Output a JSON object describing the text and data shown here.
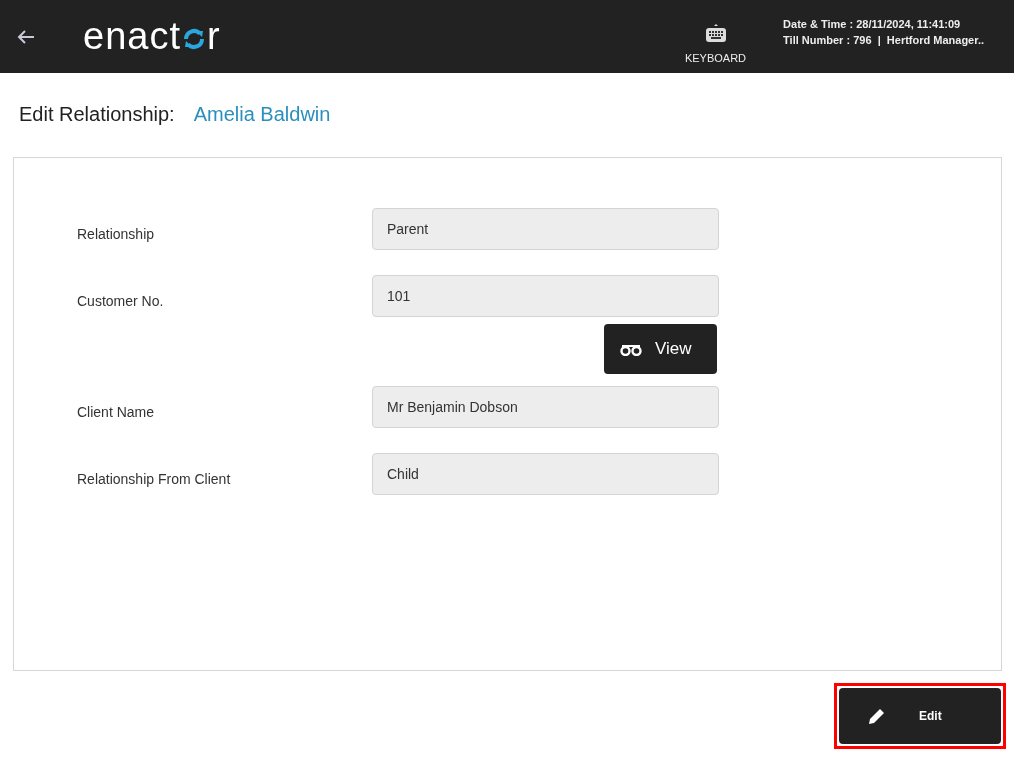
{
  "header": {
    "logo": {
      "start": "enact",
      "end": "r"
    },
    "keyboard_label": "KEYBOARD",
    "date_time": "Date & Time : 28/11/2024, 11:41:09",
    "till_info": "Till Number : 796  |  Hertford Manager.."
  },
  "page_title": {
    "label": "Edit Relationship:",
    "name": "Amelia Baldwin"
  },
  "fields": [
    {
      "kind": "field",
      "label": "Relationship",
      "value": "Parent"
    },
    {
      "kind": "field",
      "label": "Customer No.",
      "value": "101"
    },
    {
      "kind": "action",
      "label": "View"
    },
    {
      "kind": "field",
      "label": "Client Name",
      "value": "Mr Benjamin Dobson"
    },
    {
      "kind": "field",
      "label": "Relationship From Client",
      "value": "Child"
    }
  ],
  "edit_button": {
    "label": "Edit",
    "highlighted": true
  }
}
